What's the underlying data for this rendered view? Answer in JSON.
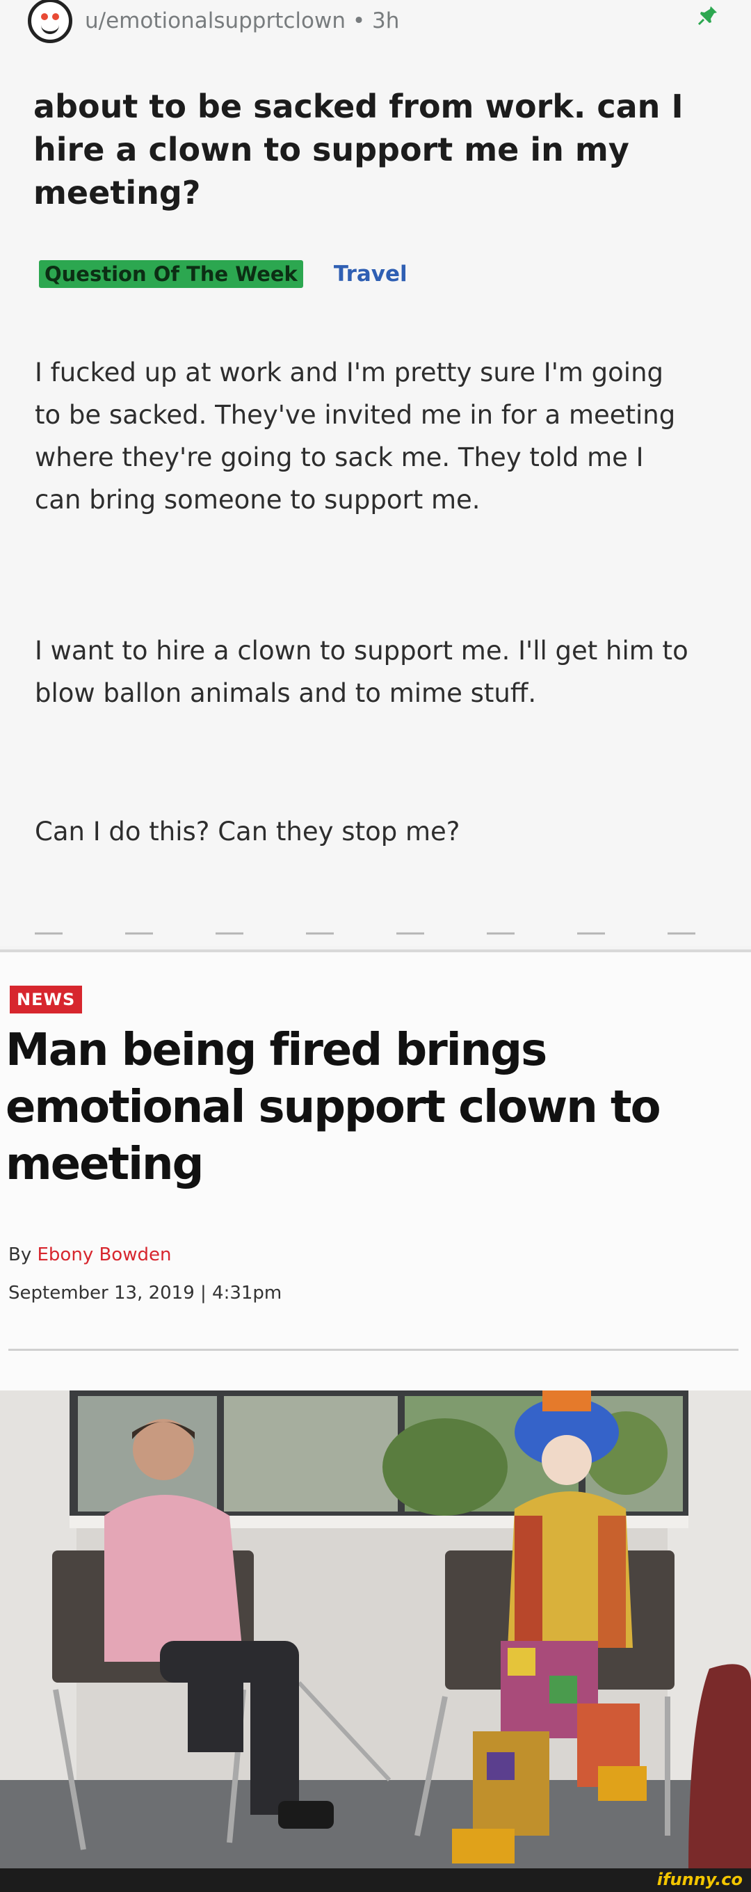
{
  "post": {
    "username": "u/emotionalsupprtclown",
    "separator": "•",
    "time": "3h",
    "title": "about to be sacked from work. can I hire a clown to support me in my meeting?",
    "flair_primary": "Question Of The Week",
    "flair_secondary": "Travel",
    "paragraphs": [
      "I fucked up at work and I'm pretty sure I'm going to be sacked. They've invited me in for a meeting where they're going to sack me. They told me I can bring someone to support me.",
      "I want to hire a clown to support me. I'll get him to blow ballon animals and to mime stuff.",
      "Can I do this? Can they stop me?"
    ]
  },
  "article": {
    "badge": "NEWS",
    "headline": "Man being fired brings emotional support clown to meeting",
    "byline_prefix": "By",
    "author": "Ebony Bowden",
    "date": "September 13, 2019 | 4:31pm"
  },
  "watermark": "ifunny.co",
  "colors": {
    "flair_green": "#2ca750",
    "flair_travel": "#2f5fb3",
    "news_red": "#d7262e",
    "watermark_yellow": "#f2c500"
  },
  "icons": {
    "avatar": "reddit-snoo-clown-icon",
    "pin": "pin-icon"
  }
}
